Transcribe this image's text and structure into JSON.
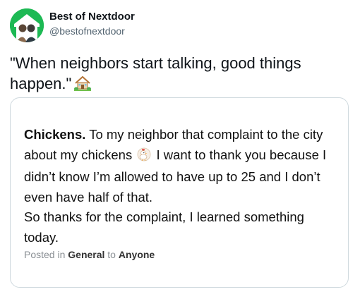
{
  "tweet": {
    "author_name": "Best of Nextdoor",
    "author_handle": "@bestofnextdoor",
    "text": "\"When neighbors start talking, good things happen.\"",
    "emoji_icon": "house-with-garden-icon"
  },
  "card": {
    "post_title": "Chickens.",
    "post_text_part1": " To my neighbor that complaint to the city about my chickens ",
    "post_emoji_icon": "chicken-icon",
    "post_text_part2": " I want to thank you because I didn’t know I’m allowed to have up to 25 and I don’t even have half of that.",
    "post_text_line2": "So thanks for the complaint, I learned something today.",
    "posted_prefix": "Posted in ",
    "category": "General",
    "posted_to": " to ",
    "audience": "Anyone"
  },
  "colors": {
    "avatar_bg": "#1db954",
    "handle": "#536471",
    "border": "#cfd9de"
  }
}
